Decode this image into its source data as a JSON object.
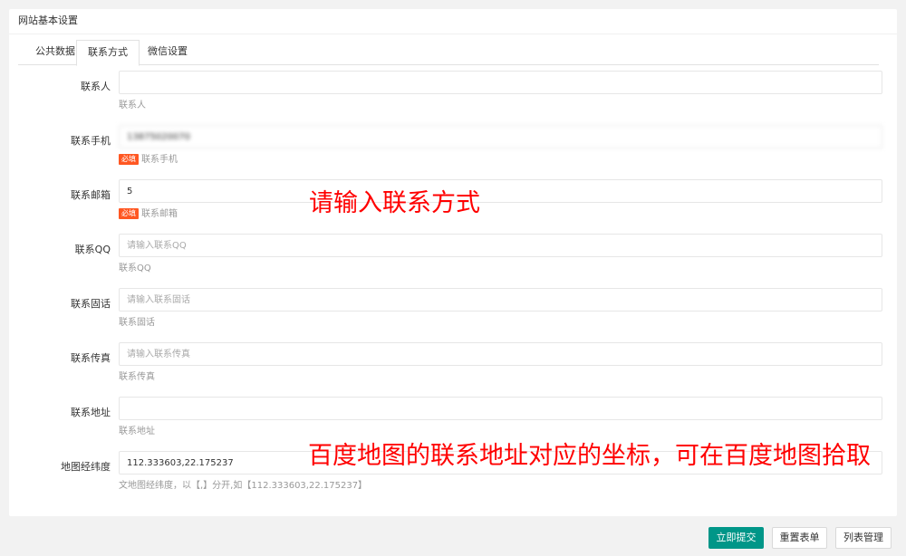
{
  "card": {
    "title": "网站基本设置"
  },
  "tabs": [
    {
      "label": "公共数据",
      "active": false
    },
    {
      "label": "联系方式",
      "active": true
    },
    {
      "label": "微信设置",
      "active": false
    }
  ],
  "fields": {
    "contact_person": {
      "label": "联系人",
      "value": "",
      "placeholder": "",
      "help": "联系人"
    },
    "phone": {
      "label": "联系手机",
      "value": "13875020070",
      "placeholder": "",
      "required_badge": "必填",
      "help": "联系手机"
    },
    "email": {
      "label": "联系邮箱",
      "value": "5",
      "placeholder": "",
      "required_badge": "必填",
      "help": "联系邮箱"
    },
    "qq": {
      "label": "联系QQ",
      "value": "",
      "placeholder": "请输入联系QQ",
      "help": "联系QQ"
    },
    "landline": {
      "label": "联系固话",
      "value": "",
      "placeholder": "请输入联系固话",
      "help": "联系固话"
    },
    "fax": {
      "label": "联系传真",
      "value": "",
      "placeholder": "请输入联系传真",
      "help": "联系传真"
    },
    "address": {
      "label": "联系地址",
      "value": "",
      "placeholder": "",
      "help": "联系地址"
    },
    "map_coords": {
      "label": "地图经纬度",
      "value": "112.333603,22.175237",
      "placeholder": "",
      "help": "文地图经纬度，以【,】分开,如【112.333603,22.175237】"
    }
  },
  "annotations": {
    "contact_hint": "请输入联系方式",
    "map_hint": "百度地图的联系地址对应的坐标，可在百度地图拾取"
  },
  "buttons": {
    "submit": "立即提交",
    "reset": "重置表单",
    "list": "列表管理"
  },
  "colors": {
    "primary": "#009688",
    "required_badge": "#ff5722",
    "annotation": "#ff0000",
    "background": "#f2f2f2"
  }
}
